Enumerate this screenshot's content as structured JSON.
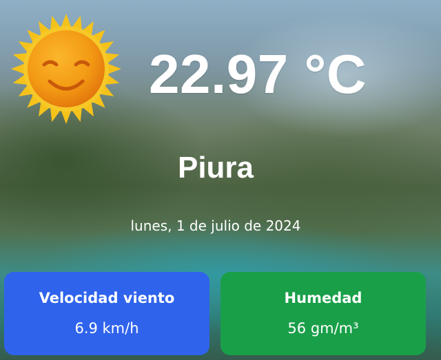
{
  "weather": {
    "icon": "sunny-smiling-sun-icon",
    "temperature": "22.97 °C",
    "city": "Piura",
    "date": "lunes, 1 de julio de 2024"
  },
  "cards": {
    "wind": {
      "title": "Velocidad viento",
      "value": "6.9 km/h"
    },
    "humidity": {
      "title": "Humedad",
      "value": "56 gm/m³"
    }
  },
  "colors": {
    "wind_card": "#2f63ec",
    "humidity_card": "#1a9f49",
    "sun_rays": "#f5c21b",
    "sun_face": "#ee8f0f",
    "text": "#ffffff"
  }
}
